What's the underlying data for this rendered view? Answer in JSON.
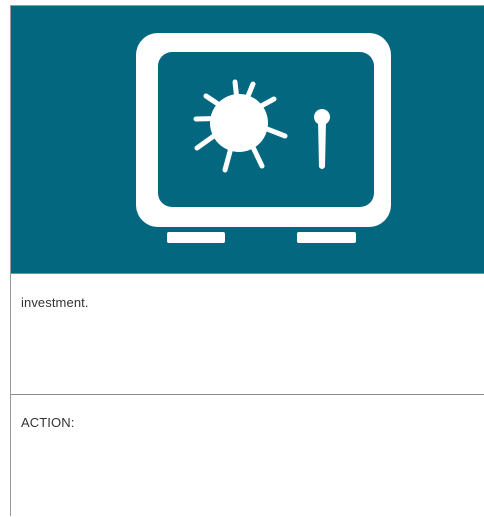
{
  "hero": {
    "icon": "safe-icon",
    "background_color": "#046780",
    "icon_color": "#ffffff"
  },
  "rows": [
    {
      "text": "investment."
    },
    {
      "text": "ACTION:"
    }
  ]
}
